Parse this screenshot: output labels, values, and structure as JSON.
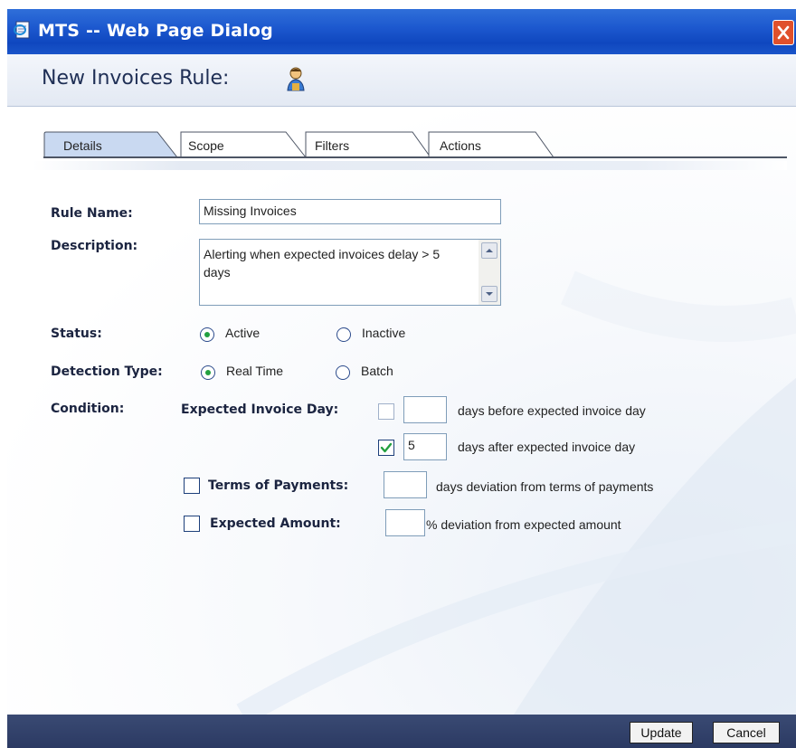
{
  "window": {
    "title": "MTS -- Web Page Dialog",
    "close_glyph": "✕"
  },
  "header": {
    "title": "New Invoices Rule:"
  },
  "tabs": [
    {
      "label": "Details",
      "active": true
    },
    {
      "label": "Scope"
    },
    {
      "label": "Filters"
    },
    {
      "label": "Actions"
    }
  ],
  "form": {
    "rule_name": {
      "label": "Rule Name:",
      "value": "Missing Invoices"
    },
    "description": {
      "label": "Description:",
      "value": "Alerting when expected invoices delay > 5 days"
    },
    "status": {
      "label": "Status:",
      "options": [
        "Active",
        "Inactive"
      ],
      "selected": "Active"
    },
    "detection_type": {
      "label": "Detection Type:",
      "options": [
        "Real Time",
        "Batch"
      ],
      "selected": "Real Time"
    },
    "condition": {
      "label": "Condition:",
      "expected_invoice_day": {
        "label": "Expected Invoice Day:",
        "before": {
          "checked": false,
          "value": "",
          "text": "days before expected invoice day"
        },
        "after": {
          "checked": true,
          "value": "5",
          "text": "days after expected invoice day"
        }
      },
      "terms_of_payments": {
        "label": "Terms of Payments:",
        "checked": false,
        "value": "",
        "text": "days deviation from terms of payments"
      },
      "expected_amount": {
        "label": "Expected Amount:",
        "checked": false,
        "value": "",
        "text": "% deviation from expected amount"
      }
    }
  },
  "footer": {
    "update_label": "Update",
    "cancel_label": "Cancel"
  },
  "colors": {
    "titlebar": "#1d59cf",
    "footer": "#2b3a63",
    "radio_dot": "#23a040",
    "check_mark": "#23a040"
  }
}
